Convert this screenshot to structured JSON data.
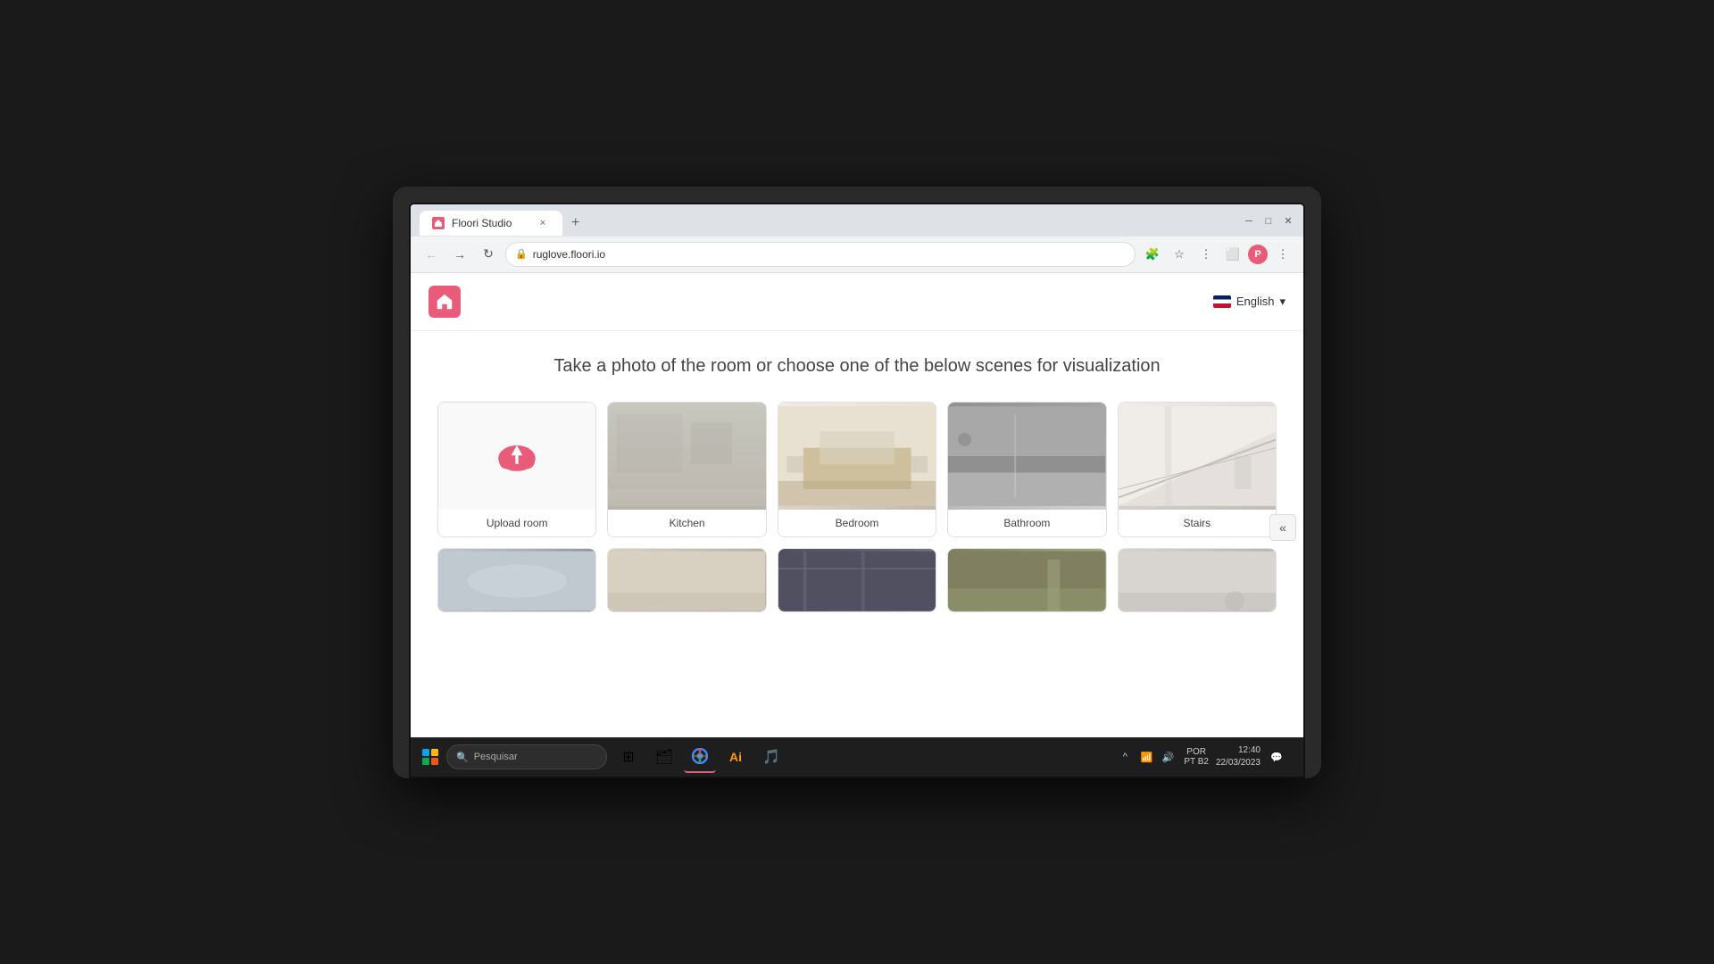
{
  "browser": {
    "tab_title": "Floori Studio",
    "tab_close": "×",
    "tab_new": "+",
    "window_controls": [
      "_",
      "□",
      "×"
    ],
    "address": "ruglove.floori.io",
    "nav_back": "←",
    "nav_forward": "→",
    "nav_refresh": "↻"
  },
  "site": {
    "headline": "Take a photo of the room or choose one of the below scenes for visualization",
    "lang_label": "English",
    "lang_arrow": "▾"
  },
  "scenes": [
    {
      "id": "upload",
      "label": "Upload room",
      "type": "upload"
    },
    {
      "id": "kitchen",
      "label": "Kitchen",
      "type": "scene",
      "img_class": "kitchen-scene"
    },
    {
      "id": "bedroom",
      "label": "Bedroom",
      "type": "scene",
      "img_class": "bedroom-scene"
    },
    {
      "id": "bathroom",
      "label": "Bathroom",
      "type": "scene",
      "img_class": "bathroom-scene"
    },
    {
      "id": "stairs",
      "label": "Stairs",
      "type": "scene",
      "img_class": "stairs-scene"
    }
  ],
  "scenes_row2": [
    {
      "id": "scene-r2-1",
      "img_class": "scene2-1-img"
    },
    {
      "id": "scene-r2-2",
      "img_class": "scene2-2-img"
    },
    {
      "id": "scene-r2-3",
      "img_class": "scene2-3-img"
    },
    {
      "id": "scene-r2-4",
      "img_class": "scene2-4-img"
    },
    {
      "id": "scene-r2-5",
      "img_class": "scene2-5-img"
    }
  ],
  "collapse_btn": "«",
  "taskbar": {
    "search_placeholder": "Pesquisar",
    "lang": "POR",
    "sub_lang": "PT B2",
    "time": "12:40",
    "date": "22/03/2023"
  }
}
